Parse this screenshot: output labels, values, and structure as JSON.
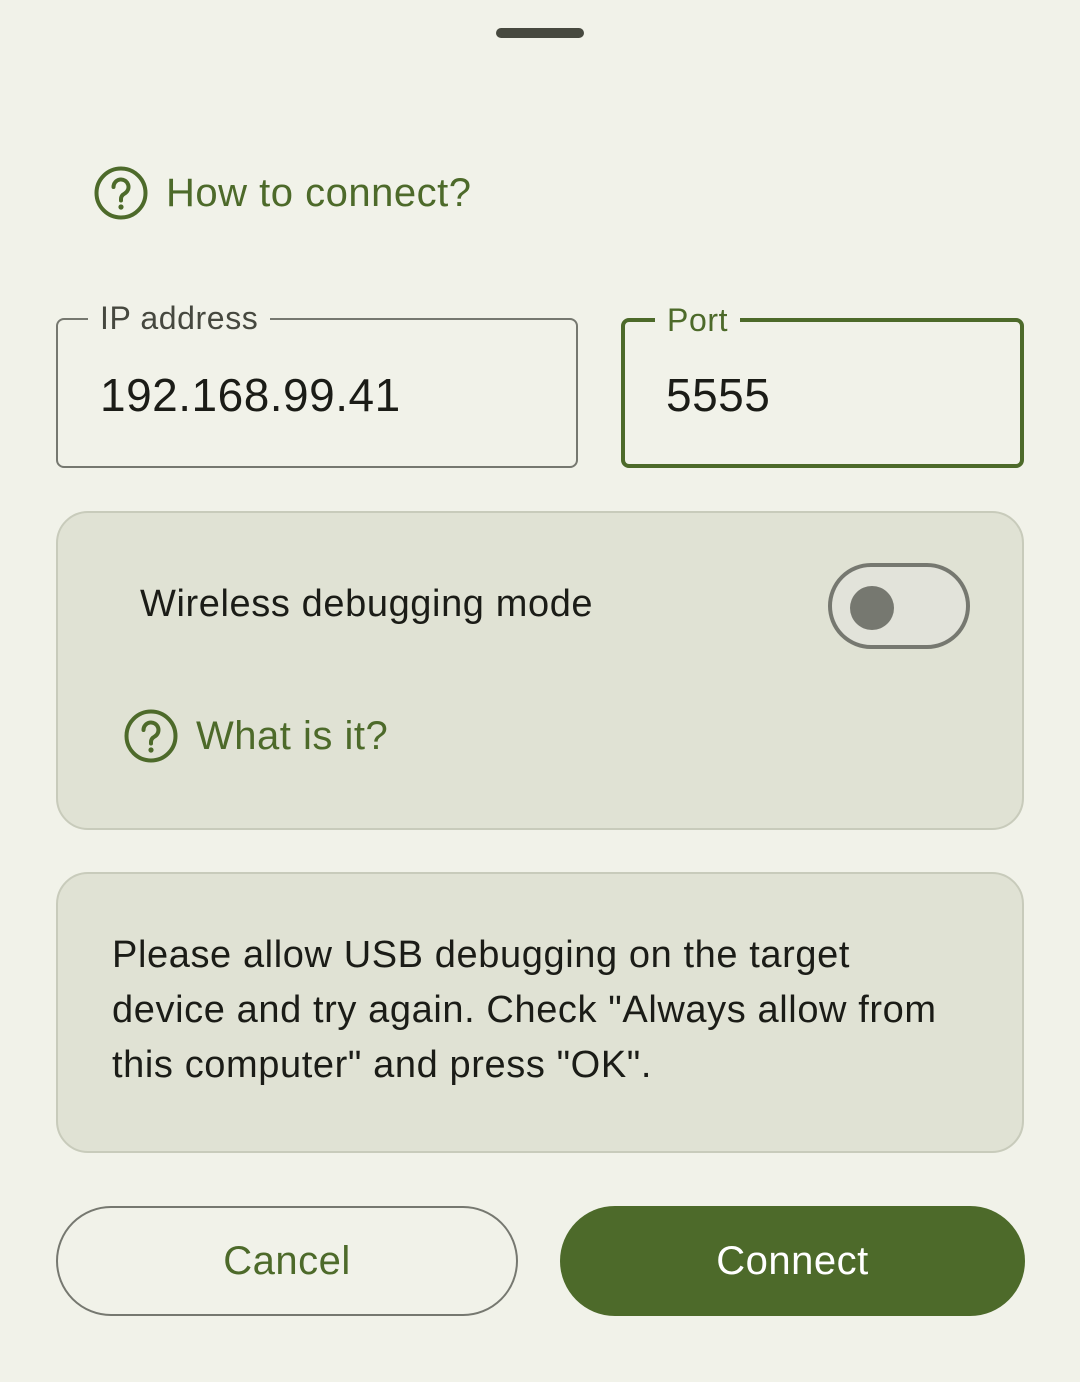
{
  "dialog": {
    "how_to_connect": {
      "label": "How to connect?",
      "icon": "help-circle-icon"
    },
    "ip_field": {
      "label": "IP address",
      "value": "192.168.99.41"
    },
    "port_field": {
      "label": "Port",
      "value": "5555"
    },
    "wireless": {
      "label": "Wireless debugging mode",
      "enabled": false,
      "help_label": "What is it?",
      "help_icon": "help-circle-icon"
    },
    "message": "Please allow USB debugging on the target device and try again. Check \"Always allow from this computer\" and press \"OK\".",
    "buttons": {
      "cancel": "Cancel",
      "connect": "Connect"
    }
  },
  "colors": {
    "background": "#f1f2e9",
    "primary": "#4d6a2a",
    "card": "#e0e2d4",
    "outline": "#767870",
    "text": "#1b1c17"
  }
}
